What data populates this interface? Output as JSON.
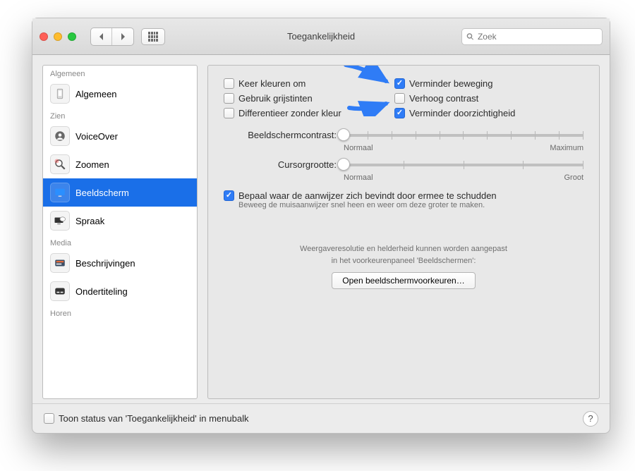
{
  "window": {
    "title": "Toegankelijkheid"
  },
  "search": {
    "placeholder": "Zoek"
  },
  "sidebar": {
    "groups": [
      {
        "header": "Algemeen",
        "items": [
          {
            "label": "Algemeen"
          }
        ]
      },
      {
        "header": "Zien",
        "items": [
          {
            "label": "VoiceOver"
          },
          {
            "label": "Zoomen"
          },
          {
            "label": "Beeldscherm",
            "selected": true
          },
          {
            "label": "Spraak"
          }
        ]
      },
      {
        "header": "Media",
        "items": [
          {
            "label": "Beschrijvingen"
          },
          {
            "label": "Ondertiteling"
          }
        ]
      },
      {
        "header": "Horen",
        "items": []
      }
    ]
  },
  "panel": {
    "checks": {
      "invert": {
        "label": "Keer kleuren om",
        "checked": false
      },
      "motion": {
        "label": "Verminder beweging",
        "checked": true
      },
      "gray": {
        "label": "Gebruik grijstinten",
        "checked": false
      },
      "contrast": {
        "label": "Verhoog contrast",
        "checked": false
      },
      "diff": {
        "label": "Differentieer zonder kleur",
        "checked": false
      },
      "trans": {
        "label": "Verminder doorzichtigheid",
        "checked": true
      }
    },
    "sliders": {
      "contrast": {
        "label": "Beeldschermcontrast:",
        "min_label": "Normaal",
        "max_label": "Maximum",
        "value": 0
      },
      "cursor": {
        "label": "Cursorgrootte:",
        "min_label": "Normaal",
        "max_label": "Groot",
        "value": 0
      }
    },
    "shake": {
      "label": "Bepaal waar de aanwijzer zich bevindt door ermee te schudden",
      "checked": true,
      "desc": "Beweeg de muisaanwijzer snel heen en weer om deze groter te maken."
    },
    "res_note_line1": "Weergaveresolutie en helderheid kunnen worden aangepast",
    "res_note_line2": "in het voorkeurenpaneel 'Beeldschermen':",
    "open_button": "Open beeldschermvoorkeuren…"
  },
  "footer": {
    "menubar": {
      "label": "Toon status van 'Toegankelijkheid' in menubalk",
      "checked": false
    }
  }
}
